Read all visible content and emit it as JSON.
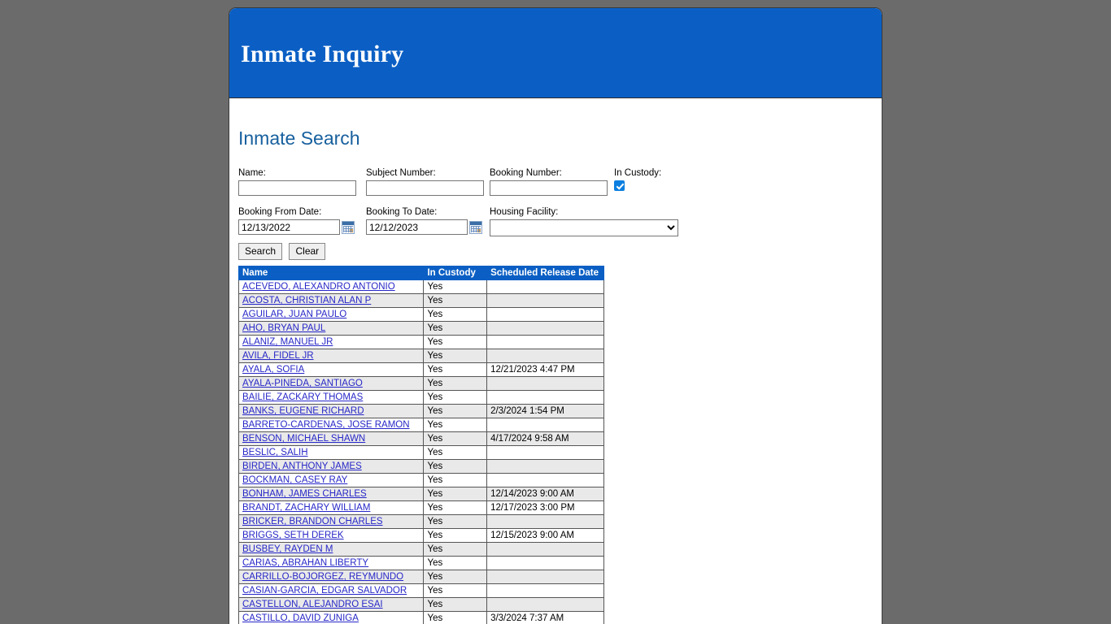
{
  "banner": {
    "title": "Inmate Inquiry"
  },
  "heading": "Inmate Search",
  "search_form": {
    "name": {
      "label": "Name:",
      "value": "",
      "placeholder": ""
    },
    "subject_number": {
      "label": "Subject Number:",
      "value": "",
      "placeholder": ""
    },
    "booking_number": {
      "label": "Booking Number:",
      "value": "",
      "placeholder": ""
    },
    "in_custody": {
      "label": "In Custody:",
      "checked": true
    },
    "booking_from_date": {
      "label": "Booking From Date:",
      "value": "12/13/2022",
      "icon": "calendar-icon"
    },
    "booking_to_date": {
      "label": "Booking To Date:",
      "value": "12/12/2023",
      "icon": "calendar-icon"
    },
    "housing_facility": {
      "label": "Housing Facility:",
      "selected": "",
      "options": [
        ""
      ]
    },
    "search_button": "Search",
    "clear_button": "Clear"
  },
  "results_table": {
    "columns": [
      "Name",
      "In Custody",
      "Scheduled Release Date"
    ],
    "rows": [
      {
        "name": "ACEVEDO, ALEXANDRO ANTONIO",
        "in_custody": "Yes",
        "release": ""
      },
      {
        "name": "ACOSTA, CHRISTIAN ALAN P",
        "in_custody": "Yes",
        "release": ""
      },
      {
        "name": "AGUILAR, JUAN PAULO",
        "in_custody": "Yes",
        "release": ""
      },
      {
        "name": "AHO, BRYAN PAUL",
        "in_custody": "Yes",
        "release": ""
      },
      {
        "name": "ALANIZ, MANUEL JR",
        "in_custody": "Yes",
        "release": ""
      },
      {
        "name": "AVILA, FIDEL JR",
        "in_custody": "Yes",
        "release": ""
      },
      {
        "name": "AYALA, SOFIA",
        "in_custody": "Yes",
        "release": "12/21/2023 4:47 PM"
      },
      {
        "name": "AYALA-PINEDA, SANTIAGO",
        "in_custody": "Yes",
        "release": ""
      },
      {
        "name": "BAILIE, ZACKARY THOMAS",
        "in_custody": "Yes",
        "release": ""
      },
      {
        "name": "BANKS, EUGENE RICHARD",
        "in_custody": "Yes",
        "release": "2/3/2024 1:54 PM"
      },
      {
        "name": "BARRETO-CARDENAS, JOSE RAMON",
        "in_custody": "Yes",
        "release": ""
      },
      {
        "name": "BENSON, MICHAEL SHAWN",
        "in_custody": "Yes",
        "release": "4/17/2024 9:58 AM"
      },
      {
        "name": "BESLIC, SALIH",
        "in_custody": "Yes",
        "release": ""
      },
      {
        "name": "BIRDEN, ANTHONY JAMES",
        "in_custody": "Yes",
        "release": ""
      },
      {
        "name": "BOCKMAN, CASEY RAY",
        "in_custody": "Yes",
        "release": ""
      },
      {
        "name": "BONHAM, JAMES CHARLES",
        "in_custody": "Yes",
        "release": "12/14/2023 9:00 AM"
      },
      {
        "name": "BRANDT, ZACHARY WILLIAM",
        "in_custody": "Yes",
        "release": "12/17/2023 3:00 PM"
      },
      {
        "name": "BRICKER, BRANDON CHARLES",
        "in_custody": "Yes",
        "release": ""
      },
      {
        "name": "BRIGGS, SETH DEREK",
        "in_custody": "Yes",
        "release": "12/15/2023 9:00 AM"
      },
      {
        "name": "BUSBEY, RAYDEN M",
        "in_custody": "Yes",
        "release": ""
      },
      {
        "name": "CARIAS, ABRAHAN LIBERTY",
        "in_custody": "Yes",
        "release": ""
      },
      {
        "name": "CARRILLO-BOJORGEZ, REYMUNDO",
        "in_custody": "Yes",
        "release": ""
      },
      {
        "name": "CASIAN-GARCIA, EDGAR SALVADOR",
        "in_custody": "Yes",
        "release": ""
      },
      {
        "name": "CASTELLON, ALEJANDRO ESAI",
        "in_custody": "Yes",
        "release": ""
      },
      {
        "name": "CASTILLO, DAVID ZUNIGA",
        "in_custody": "Yes",
        "release": "3/3/2024 7:37 AM"
      }
    ]
  },
  "colors": {
    "banner_blue": "#0b5fc4",
    "page_background": "#6b6b6b",
    "heading_blue": "#17609e",
    "link_blue": "#2727c8",
    "row_alt": "#e9e9e9"
  }
}
